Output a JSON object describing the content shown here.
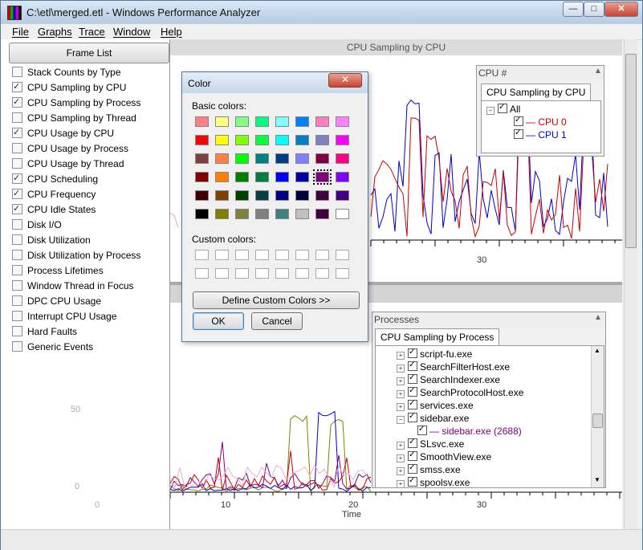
{
  "window": {
    "title": "C:\\etl\\merged.etl - Windows Performance Analyzer"
  },
  "titlebar_buttons": {
    "minimize": "—",
    "maximize": "□",
    "close": "✕"
  },
  "menu": [
    {
      "label": "File",
      "name": "menu-file"
    },
    {
      "label": "Graphs",
      "name": "menu-graphs"
    },
    {
      "label": "Trace",
      "name": "menu-trace"
    },
    {
      "label": "Window",
      "name": "menu-window"
    },
    {
      "label": "Help",
      "name": "menu-help"
    }
  ],
  "frame_list_button": "Frame List",
  "graph_list": [
    {
      "label": "Stack Counts by Type",
      "checked": false
    },
    {
      "label": "CPU Sampling by CPU",
      "checked": true
    },
    {
      "label": "CPU Sampling by Process",
      "checked": true
    },
    {
      "label": "CPU Sampling by Thread",
      "checked": false
    },
    {
      "label": "CPU Usage by CPU",
      "checked": true
    },
    {
      "label": "CPU Usage by Process",
      "checked": false
    },
    {
      "label": "CPU Usage by Thread",
      "checked": false
    },
    {
      "label": "CPU Scheduling",
      "checked": true
    },
    {
      "label": "CPU Frequency",
      "checked": true
    },
    {
      "label": "CPU Idle States",
      "checked": true
    },
    {
      "label": "Disk I/O",
      "checked": false
    },
    {
      "label": "Disk Utilization",
      "checked": false
    },
    {
      "label": "Disk Utilization by Process",
      "checked": false
    },
    {
      "label": "Process Lifetimes",
      "checked": false
    },
    {
      "label": "Window Thread in Focus",
      "checked": false
    },
    {
      "label": "DPC CPU Usage",
      "checked": false
    },
    {
      "label": "Interrupt CPU Usage",
      "checked": false
    },
    {
      "label": "Hard Faults",
      "checked": false
    },
    {
      "label": "Generic Events",
      "checked": false
    }
  ],
  "panels": {
    "top": {
      "title": "CPU Sampling by CPU",
      "x_tick": "30"
    },
    "bottom": {
      "x_ticks": [
        "0",
        "10",
        "20",
        "30"
      ],
      "y_ticks": [
        "50",
        "0"
      ],
      "x_label": "Time"
    }
  },
  "cpu_legend": {
    "header": "CPU #",
    "tab": "CPU Sampling by CPU",
    "root": "All",
    "items": [
      {
        "label": "CPU 0",
        "color": "#cc0000"
      },
      {
        "label": "CPU 1",
        "color": "#0000cc"
      }
    ]
  },
  "process_legend": {
    "header": "Processes",
    "tab": "CPU Sampling by Process",
    "items": [
      {
        "label": "script-fu.exe",
        "expanded": false
      },
      {
        "label": "SearchFilterHost.exe",
        "expanded": false
      },
      {
        "label": "SearchIndexer.exe",
        "expanded": false
      },
      {
        "label": "SearchProtocolHost.exe",
        "expanded": false
      },
      {
        "label": "services.exe",
        "expanded": false
      },
      {
        "label": "sidebar.exe",
        "expanded": true
      },
      {
        "label": "sidebar.exe (2688)",
        "child": true,
        "color": "#800080"
      },
      {
        "label": "SLsvc.exe",
        "expanded": false
      },
      {
        "label": "SmoothView.exe",
        "expanded": false
      },
      {
        "label": "smss.exe",
        "expanded": false
      },
      {
        "label": "spoolsv.exe",
        "expanded": false
      }
    ]
  },
  "color_dialog": {
    "title": "Color",
    "close": "✕",
    "basic_label": "Basic colors:",
    "custom_label": "Custom colors:",
    "define_button": "Define Custom Colors >>",
    "ok_button": "OK",
    "cancel_button": "Cancel",
    "selected": "#800080",
    "basic_colors": [
      "#ff8080",
      "#ffff80",
      "#80ff80",
      "#00ff80",
      "#80ffff",
      "#0080ff",
      "#ff80c0",
      "#ff80ff",
      "#ff0000",
      "#ffff00",
      "#80ff00",
      "#00ff40",
      "#00ffff",
      "#0080c0",
      "#8080c0",
      "#ff00ff",
      "#804040",
      "#ff8040",
      "#00ff00",
      "#008080",
      "#004080",
      "#8080ff",
      "#800040",
      "#ff0080",
      "#800000",
      "#ff8000",
      "#008000",
      "#008040",
      "#0000ff",
      "#0000a0",
      "#800080",
      "#8000ff",
      "#400000",
      "#804000",
      "#004000",
      "#004040",
      "#000080",
      "#000040",
      "#400040",
      "#400080",
      "#000000",
      "#808000",
      "#808040",
      "#808080",
      "#408080",
      "#c0c0c0",
      "#400040",
      "#ffffff"
    ]
  }
}
